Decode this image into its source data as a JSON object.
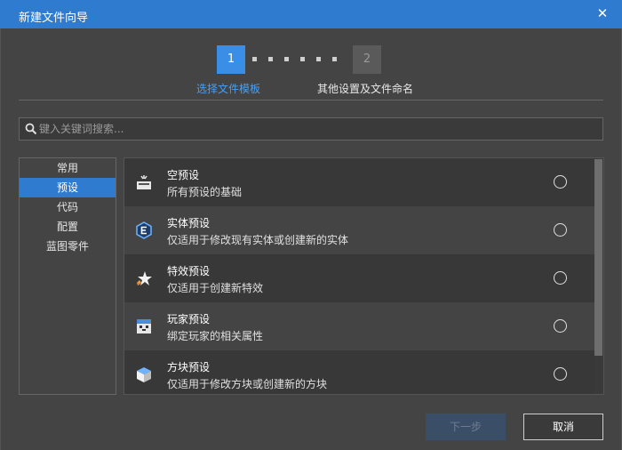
{
  "window": {
    "title": "新建文件向导",
    "close_symbol": "✕"
  },
  "steps": [
    {
      "number": "1",
      "label": "选择文件模板",
      "active": true
    },
    {
      "number": "2",
      "label": "其他设置及文件命名",
      "active": false
    }
  ],
  "search": {
    "placeholder": "键入关键词搜索...",
    "value": ""
  },
  "categories": [
    "常用",
    "预设",
    "代码",
    "配置",
    "蓝图零件"
  ],
  "selected_category": "预设",
  "templates": [
    {
      "name": "空预设",
      "desc": "所有预设的基础",
      "icon": "empty-preset-icon"
    },
    {
      "name": "实体预设",
      "desc": "仅适用于修改现有实体或创建新的实体",
      "icon": "entity-preset-icon"
    },
    {
      "name": "特效预设",
      "desc": "仅适用于创建新特效",
      "icon": "effect-preset-icon"
    },
    {
      "name": "玩家预设",
      "desc": "绑定玩家的相关属性",
      "icon": "player-preset-icon"
    },
    {
      "name": "方块预设",
      "desc": "仅适用于修改方块或创建新的方块",
      "icon": "block-preset-icon"
    }
  ],
  "buttons": {
    "next": "下一步",
    "cancel": "取消"
  },
  "colors": {
    "accent": "#2f7bd0",
    "active_step": "#3a8ee6",
    "active_label": "#4a9ef0"
  }
}
